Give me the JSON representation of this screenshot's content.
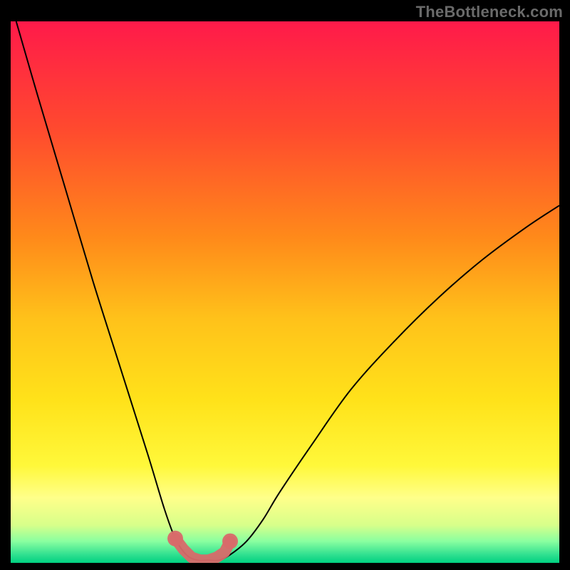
{
  "watermark": "TheBottleneck.com",
  "colors": {
    "frame_bg": "#000000",
    "watermark": "#6a6a6a",
    "gradient_stops": [
      {
        "offset": 0.0,
        "color": "#ff1a4a"
      },
      {
        "offset": 0.2,
        "color": "#ff4a2e"
      },
      {
        "offset": 0.4,
        "color": "#ff8a1a"
      },
      {
        "offset": 0.55,
        "color": "#ffc21a"
      },
      {
        "offset": 0.7,
        "color": "#ffe21a"
      },
      {
        "offset": 0.82,
        "color": "#fff83a"
      },
      {
        "offset": 0.88,
        "color": "#ffff8a"
      },
      {
        "offset": 0.93,
        "color": "#d8ff8a"
      },
      {
        "offset": 0.96,
        "color": "#8affa0"
      },
      {
        "offset": 0.985,
        "color": "#30e090"
      },
      {
        "offset": 1.0,
        "color": "#00d080"
      }
    ],
    "curve": "#000000",
    "marker_stroke": "#d86a6a",
    "marker_fill": "#d86a6a"
  },
  "chart_data": {
    "type": "line",
    "title": "",
    "xlabel": "",
    "ylabel": "",
    "xlim": [
      0,
      100
    ],
    "ylim": [
      0,
      100
    ],
    "series": [
      {
        "name": "bottleneck-curve",
        "x": [
          1,
          5,
          10,
          15,
          20,
          25,
          28,
          30,
          32,
          34,
          36,
          38,
          40,
          43,
          46,
          49,
          55,
          62,
          70,
          78,
          86,
          94,
          100
        ],
        "y": [
          100,
          86,
          69,
          52,
          36,
          20,
          10,
          4.5,
          1.5,
          0.5,
          0.5,
          0.5,
          1.5,
          4,
          8,
          13,
          22,
          32,
          41,
          49,
          56,
          62,
          66
        ]
      }
    ],
    "marker_region": {
      "x": [
        30,
        31.5,
        33,
        34.5,
        36,
        37.5,
        39,
        40
      ],
      "y": [
        4.5,
        2.5,
        1.0,
        0.5,
        0.5,
        1.0,
        2.0,
        4.0
      ]
    }
  }
}
